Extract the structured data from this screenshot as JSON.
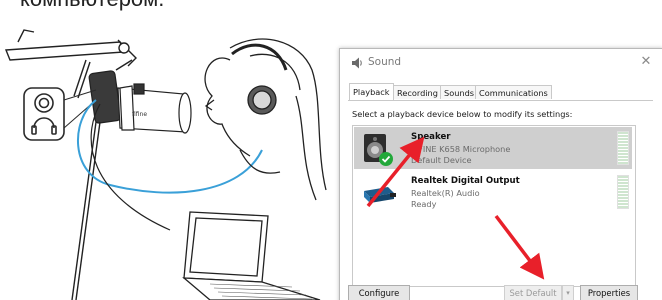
{
  "caption_text": "компьютером.",
  "illustration": {
    "mic_brand": "fifine",
    "icon_names": [
      "microphone-boom-arm",
      "headphones-icon",
      "laptop",
      "person-with-headphones"
    ]
  },
  "dialog": {
    "title": "Sound",
    "close_glyph": "✕",
    "tabs": [
      {
        "label": "Playback",
        "active": true
      },
      {
        "label": "Recording",
        "active": false
      },
      {
        "label": "Sounds",
        "active": false
      },
      {
        "label": "Communications",
        "active": false
      }
    ],
    "instruction": "Select a playback device below to modify its settings:",
    "devices": [
      {
        "name": "Speaker",
        "description": "FIFINE K658 Microphone",
        "status": "Default Device",
        "selected": true,
        "icon": "speaker-icon",
        "badge": "green-check"
      },
      {
        "name": "Realtek Digital Output",
        "description": "Realtek(R) Audio",
        "status": "Ready",
        "selected": false,
        "icon": "digital-output-icon"
      }
    ],
    "buttons": {
      "configure": "Configure",
      "set_default": "Set Default",
      "set_default_dropdown": "▾",
      "properties": "Properties"
    }
  },
  "colors": {
    "cable_blue": "#3aa0d8",
    "arrow_red": "#e8202a",
    "check_green": "#22a83a",
    "selected_row": "#cfcfcf"
  }
}
